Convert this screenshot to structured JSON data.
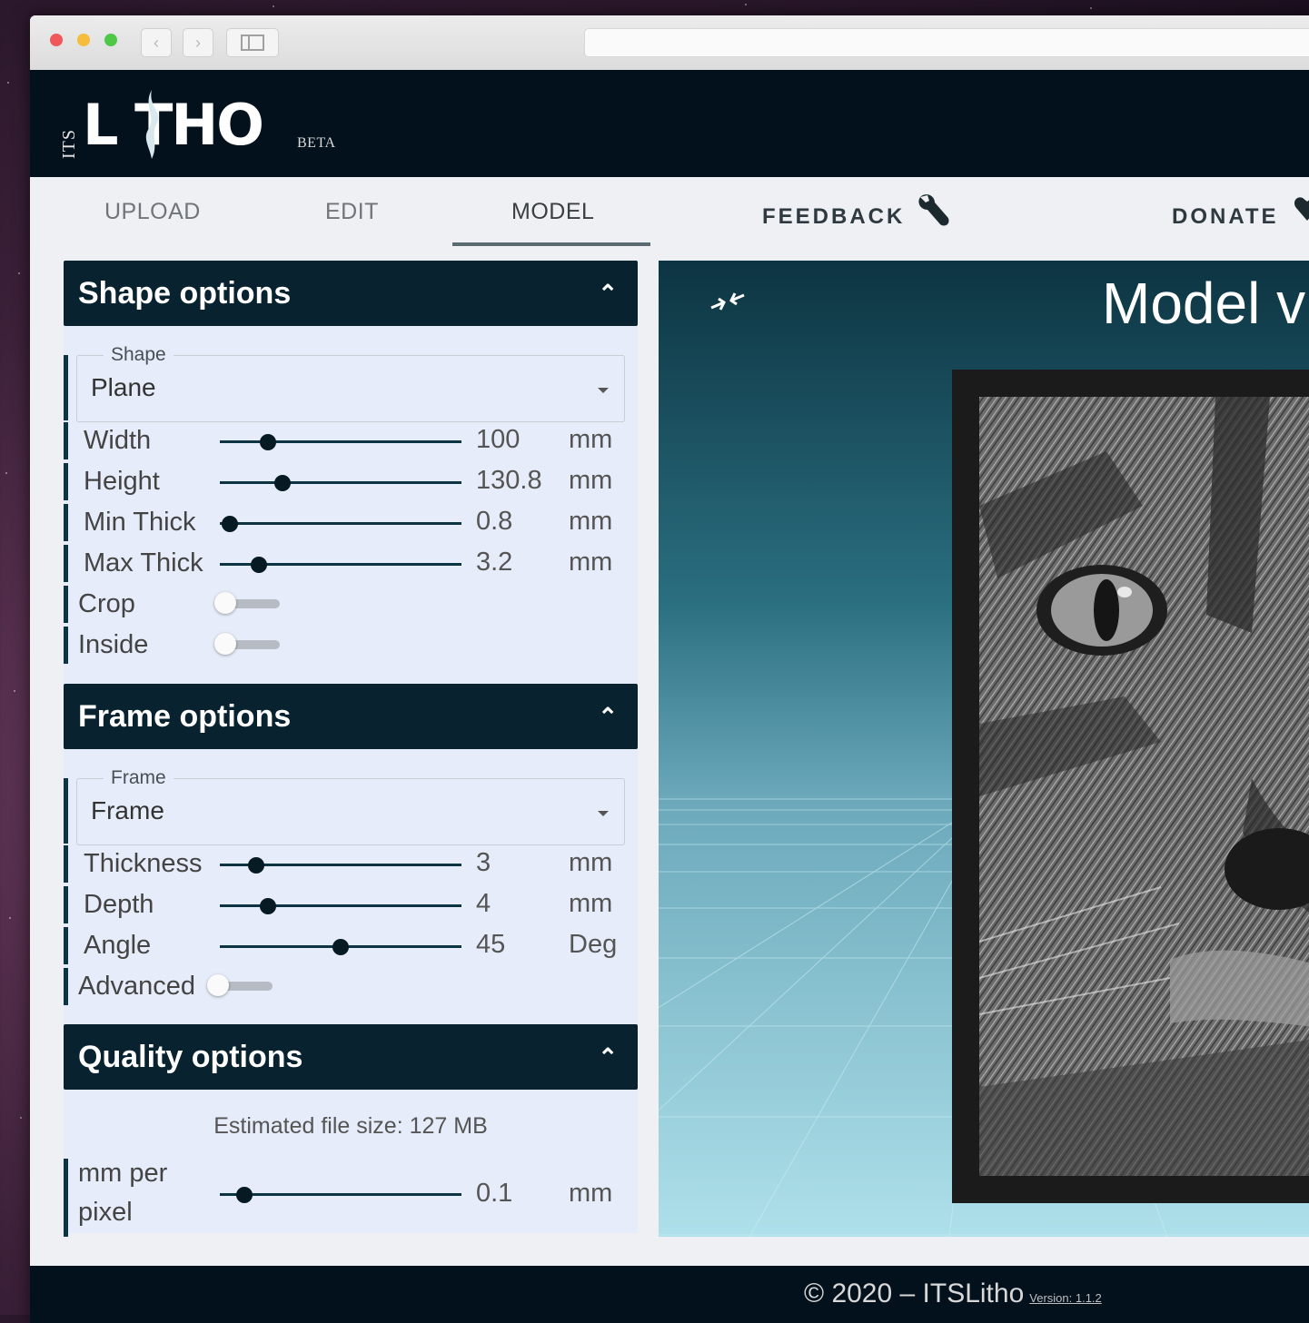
{
  "app": {
    "logo_its": "ITS",
    "logo_main": "L THO",
    "logo_beta": "BETA"
  },
  "tabs": [
    {
      "label": "UPLOAD",
      "active": false
    },
    {
      "label": "EDIT",
      "active": false
    },
    {
      "label": "MODEL",
      "active": true
    }
  ],
  "nav": {
    "feedback": "FEEDBACK",
    "donate": "DONATE"
  },
  "shape_options": {
    "title": "Shape options",
    "shape_legend": "Shape",
    "shape_value": "Plane",
    "sliders": [
      {
        "label": "Width",
        "value": "100",
        "unit": "mm",
        "fraction": 0.2
      },
      {
        "label": "Height",
        "value": "130.8",
        "unit": "mm",
        "fraction": 0.26
      },
      {
        "label": "Min Thick",
        "value": "0.8",
        "unit": "mm",
        "fraction": 0.04
      },
      {
        "label": "Max Thick",
        "value": "3.2",
        "unit": "mm",
        "fraction": 0.16
      }
    ],
    "toggles": [
      {
        "label": "Crop",
        "on": false
      },
      {
        "label": "Inside",
        "on": false
      }
    ]
  },
  "frame_options": {
    "title": "Frame options",
    "frame_legend": "Frame",
    "frame_value": "Frame",
    "sliders": [
      {
        "label": "Thickness",
        "value": "3",
        "unit": "mm",
        "fraction": 0.15
      },
      {
        "label": "Depth",
        "value": "4",
        "unit": "mm",
        "fraction": 0.2
      },
      {
        "label": "Angle",
        "value": "45",
        "unit": "Deg",
        "fraction": 0.5
      }
    ],
    "toggles": [
      {
        "label": "Advanced",
        "on": false
      }
    ]
  },
  "quality_options": {
    "title": "Quality options",
    "file_size": "Estimated file size: 127 MB",
    "slider": {
      "label_line1": "mm per",
      "label_line2": "pixel",
      "value": "0.1",
      "unit": "mm",
      "fraction": 0.1
    }
  },
  "viewer": {
    "title": "Model v"
  },
  "footer": {
    "text": "© 2020 – ITSLitho",
    "version": "Version: 1.1.2"
  },
  "colors": {
    "header_bg": "#03111d",
    "panel_head_bg": "#08232f",
    "panel_body_bg": "#e6ecf9",
    "accent": "#0d3442"
  }
}
